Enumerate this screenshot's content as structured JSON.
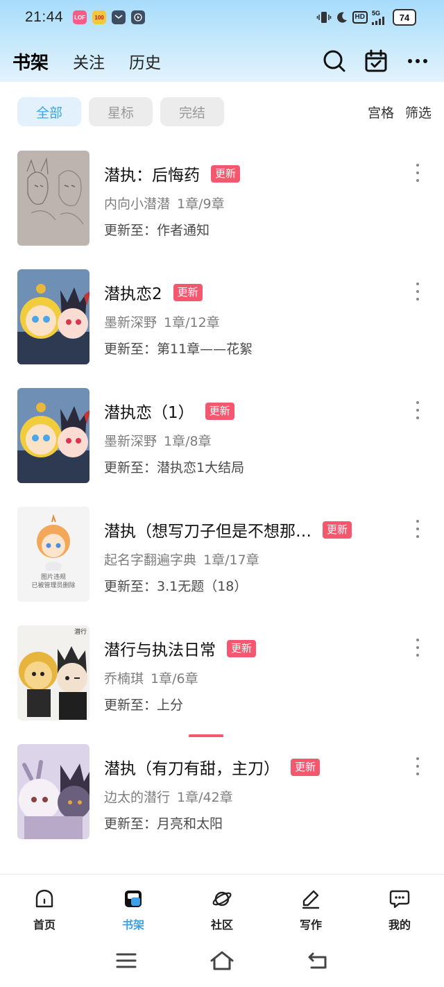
{
  "status": {
    "time": "21:44",
    "network": "5G",
    "hd": "HD",
    "battery": "74",
    "apps": [
      {
        "label": "lofter",
        "color": "#f55c88"
      },
      {
        "label": "100",
        "color": "#f5c83c"
      },
      {
        "label": "mail",
        "color": "#3d4e63"
      },
      {
        "label": "play",
        "color": "#3d4e63"
      }
    ]
  },
  "nav": {
    "tabs": [
      "书架",
      "关注",
      "历史"
    ],
    "active_tab": "书架"
  },
  "filters": {
    "chips": [
      "全部",
      "星标",
      "完结"
    ],
    "active_chip": "全部",
    "grid": "宫格",
    "filter": "筛选"
  },
  "badge_label": "更新",
  "books": [
    {
      "title": "潜执：后悔药",
      "author": "内向小潜潜",
      "progress": "1章/9章",
      "update": "更新至：作者通知"
    },
    {
      "title": "潜执恋2",
      "author": "墨新深野",
      "progress": "1章/12章",
      "update": "更新至：第11章——花絮"
    },
    {
      "title": "潜执恋（1）",
      "author": "墨新深野",
      "progress": "1章/8章",
      "update": "更新至：潜执恋1大结局"
    },
    {
      "title": "潜执（想写刀子但是不想那…",
      "author": "起名字翻遍字典",
      "progress": "1章/17章",
      "update": "更新至：3.1无题（18）"
    },
    {
      "title": "潜行与执法日常",
      "author": "乔楠琪",
      "progress": "1章/6章",
      "update": "更新至：上分"
    },
    {
      "title": "潜执（有刀有甜，主刀）",
      "author": "边太的潜行",
      "progress": "1章/42章",
      "update": "更新至：月亮和太阳"
    }
  ],
  "covers": {
    "deleted_notice_line1": "图片违规",
    "deleted_notice_line2": "已被管理员删除",
    "corner_text": "潜行"
  },
  "bottom_nav": [
    {
      "label": "首页",
      "icon": "home-icon"
    },
    {
      "label": "书架",
      "icon": "bookshelf-icon"
    },
    {
      "label": "社区",
      "icon": "planet-icon"
    },
    {
      "label": "写作",
      "icon": "pen-icon"
    },
    {
      "label": "我的",
      "icon": "chat-bubble-icon"
    }
  ],
  "colors": {
    "accent": "#3aa0ea",
    "badge": "#f4576e",
    "header_gradient_top": "#a7dcfb"
  }
}
